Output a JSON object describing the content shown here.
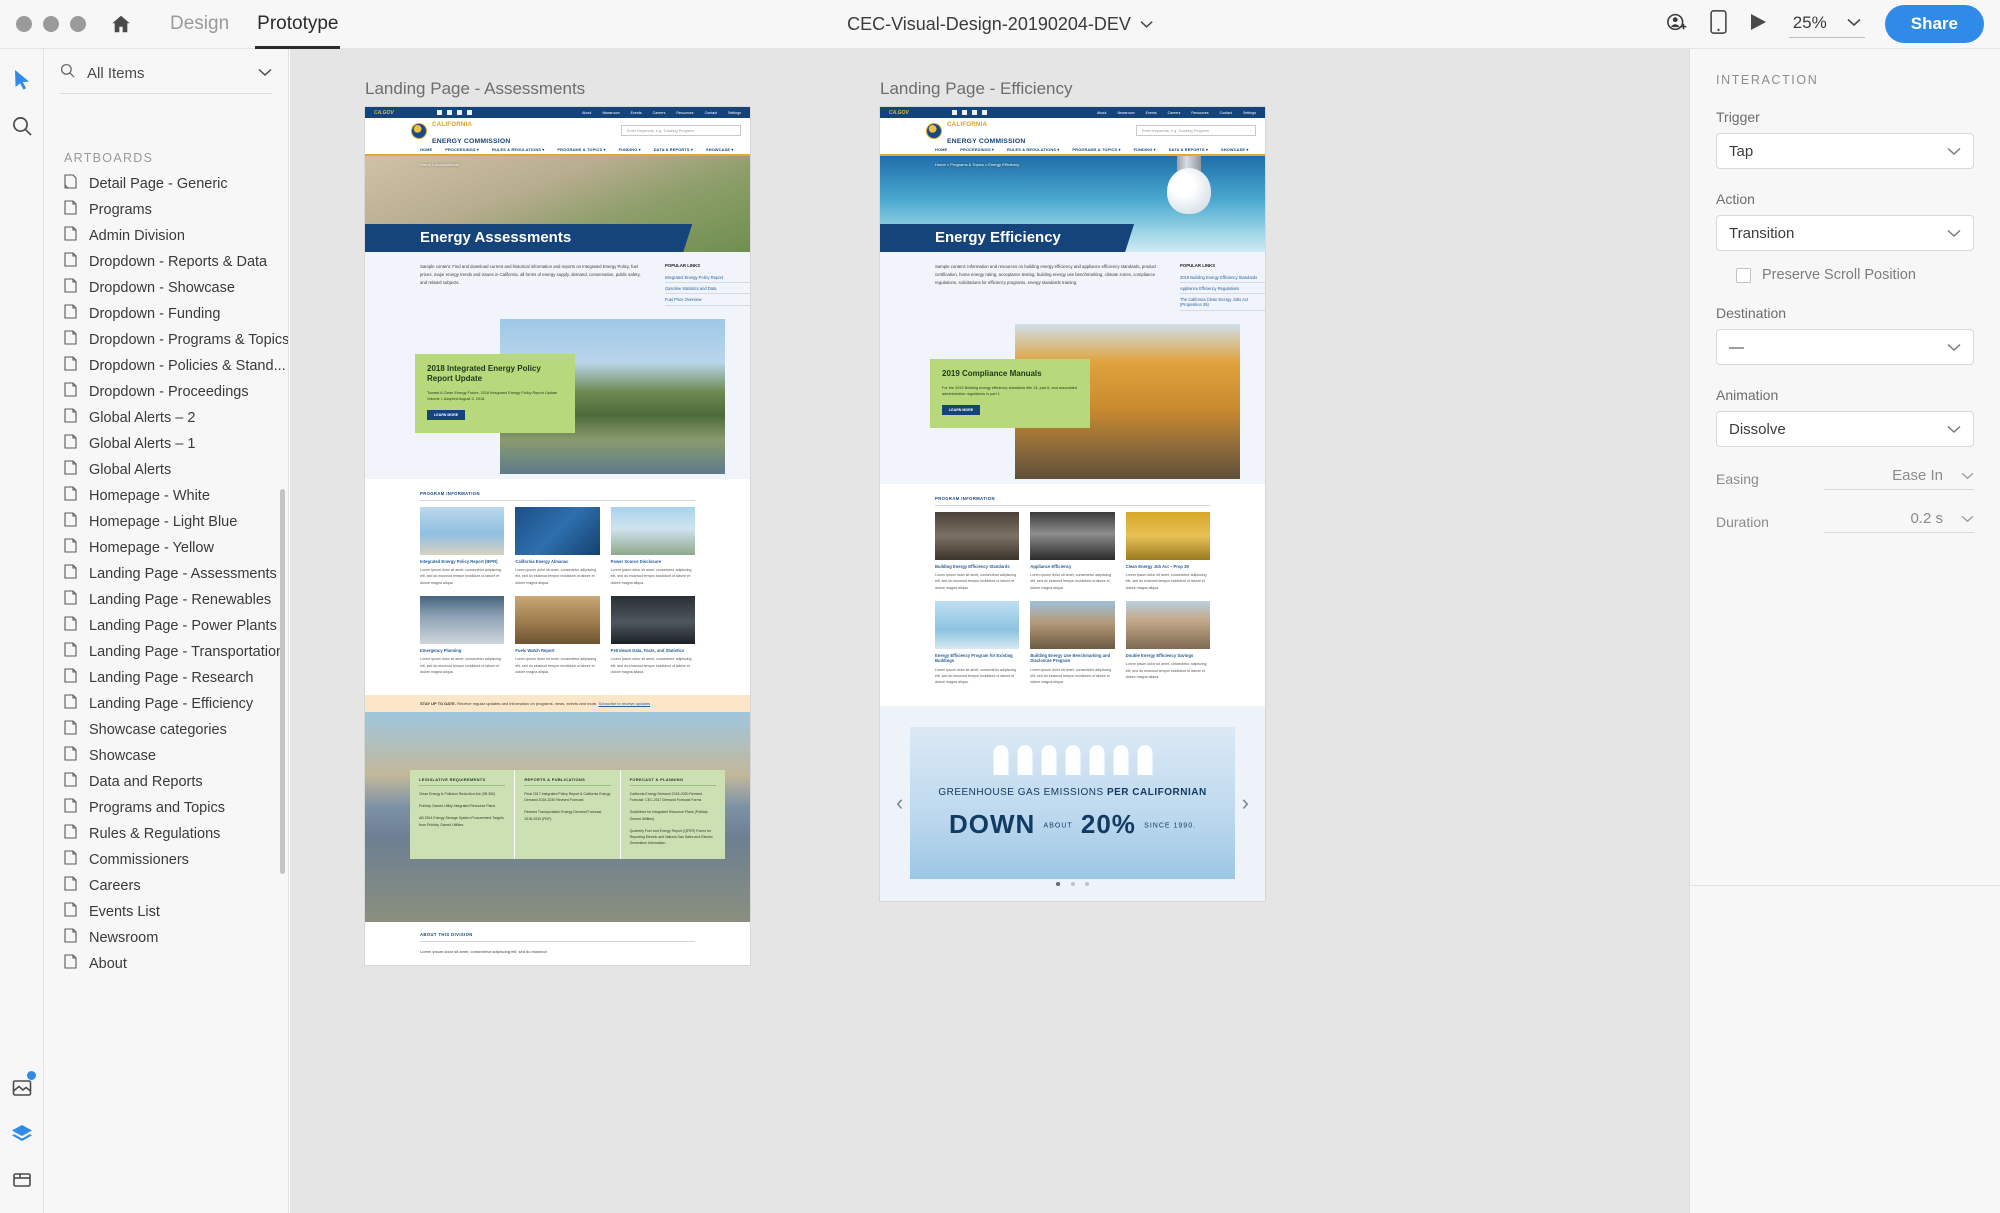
{
  "app": {
    "window_controls": [
      "close",
      "minimize",
      "maximize"
    ],
    "home_icon": "home-icon",
    "tabs": [
      {
        "label": "Design",
        "active": false
      },
      {
        "label": "Prototype",
        "active": true
      }
    ],
    "document_title": "CEC-Visual-Design-20190204-DEV",
    "title_chevron": "chevron-down-icon",
    "toolbar_right": {
      "coedit_icon": "add-collaborator-icon",
      "device_preview_icon": "mobile-device-icon",
      "play_icon": "play-desktop-preview-icon",
      "zoom_value": "25%",
      "zoom_chevron": "chevron-down-icon",
      "share_label": "Share"
    }
  },
  "toolrail": {
    "tools": [
      {
        "name": "select-tool",
        "icon": "cursor-icon",
        "selected": true
      },
      {
        "name": "zoom-tool",
        "icon": "magnifier-icon",
        "selected": false
      }
    ],
    "bottom_tools": [
      {
        "name": "assets-panel",
        "icon": "assets-icon",
        "badge": true
      },
      {
        "name": "layers-panel",
        "icon": "layers-icon",
        "selected": true
      },
      {
        "name": "libraries-panel",
        "icon": "libraries-icon",
        "selected": false
      }
    ]
  },
  "left_panel": {
    "search": {
      "icon": "search-icon",
      "value": "All Items",
      "chevron": "chevron-down-icon"
    },
    "section_header": "ARTBOARDS",
    "artboards": [
      {
        "label": "Detail Page - Generic",
        "icon": "artboard-icon-alt"
      },
      {
        "label": "Programs",
        "icon": "artboard-icon"
      },
      {
        "label": "Admin Division",
        "icon": "artboard-icon"
      },
      {
        "label": "Dropdown - Reports & Data",
        "icon": "artboard-icon"
      },
      {
        "label": "Dropdown - Showcase",
        "icon": "artboard-icon"
      },
      {
        "label": "Dropdown - Funding",
        "icon": "artboard-icon"
      },
      {
        "label": "Dropdown - Programs & Topics",
        "icon": "artboard-icon"
      },
      {
        "label": "Dropdown - Policies & Stand...",
        "icon": "artboard-icon"
      },
      {
        "label": "Dropdown - Proceedings",
        "icon": "artboard-icon"
      },
      {
        "label": "Global Alerts – 2",
        "icon": "artboard-icon"
      },
      {
        "label": "Global Alerts – 1",
        "icon": "artboard-icon"
      },
      {
        "label": "Global Alerts",
        "icon": "artboard-icon"
      },
      {
        "label": "Homepage - White",
        "icon": "artboard-icon"
      },
      {
        "label": "Homepage - Light Blue",
        "icon": "artboard-icon"
      },
      {
        "label": "Homepage - Yellow",
        "icon": "artboard-icon"
      },
      {
        "label": "Landing Page - Assessments",
        "icon": "artboard-icon"
      },
      {
        "label": "Landing Page - Renewables",
        "icon": "artboard-icon"
      },
      {
        "label": "Landing Page - Power Plants",
        "icon": "artboard-icon"
      },
      {
        "label": "Landing Page - Transportation",
        "icon": "artboard-icon"
      },
      {
        "label": "Landing Page - Research",
        "icon": "artboard-icon"
      },
      {
        "label": "Landing Page - Efficiency",
        "icon": "artboard-icon"
      },
      {
        "label": "Showcase categories",
        "icon": "artboard-icon"
      },
      {
        "label": "Showcase",
        "icon": "artboard-icon"
      },
      {
        "label": "Data and Reports",
        "icon": "artboard-icon"
      },
      {
        "label": "Programs and Topics",
        "icon": "artboard-icon"
      },
      {
        "label": "Rules & Regulations",
        "icon": "artboard-icon"
      },
      {
        "label": "Commissioners",
        "icon": "artboard-icon"
      },
      {
        "label": "Careers",
        "icon": "artboard-icon"
      },
      {
        "label": "Events List",
        "icon": "artboard-icon"
      },
      {
        "label": "Newsroom",
        "icon": "artboard-icon"
      },
      {
        "label": "About",
        "icon": "artboard-icon"
      }
    ]
  },
  "right_panel": {
    "title": "INTERACTION",
    "trigger": {
      "label": "Trigger",
      "value": "Tap"
    },
    "action": {
      "label": "Action",
      "value": "Transition"
    },
    "preserve_scroll": {
      "label": "Preserve Scroll Position",
      "checked": false
    },
    "destination": {
      "label": "Destination",
      "value": "—"
    },
    "animation": {
      "label": "Animation",
      "value": "Dissolve"
    },
    "easing": {
      "label": "Easing",
      "value": "Ease In"
    },
    "duration": {
      "label": "Duration",
      "value": "0.2 s"
    }
  },
  "canvas": {
    "artboards": [
      {
        "title": "Landing Page - Assessments",
        "site": {
          "utility_nav": [
            "About",
            "Newsroom",
            "Events",
            "Careers",
            "Resources",
            "Contact",
            "Settings"
          ],
          "social_icons": [
            "ca-gov-icon",
            "home-icon",
            "twitter-icon",
            "linkedin-icon",
            "instagram-icon"
          ],
          "brand_line1": "CALIFORNIA",
          "brand_line2": "ENERGY COMMISSION",
          "search_placeholder": "Enter Keywords, e.g. Tracking Progress",
          "main_nav": [
            "HOME",
            "PROCEEDINGS",
            "RULES & REGULATIONS",
            "PROGRAMS & TOPICS",
            "FUNDING",
            "DATA & REPORTS",
            "SHOWCASE"
          ],
          "breadcrumb": "Home  >  Assessments",
          "hero_title": "Energy Assessments",
          "intro": "Sample content: Find and download current and historical information and reports on Integrated Energy Policy, fuel prices, major energy trends and issues in California, all forms of energy supply, demand, conservation, public safety, and related subjects.",
          "popular_links_header": "POPULAR LINKS",
          "popular_links": [
            "Integrated Energy Policy Report",
            "Gasoline Statistics and Data",
            "Fuel Price Overview"
          ],
          "feature": {
            "title": "2018 Integrated Energy Policy Report Update",
            "body": "Toward A Clean Energy Future, 2018 Integrated Energy Policy Report Update Volume I, Adopted August 3, 2018.",
            "button": "LEARN MORE"
          },
          "program_info_header": "PROGRAM INFORMATION",
          "cards": [
            {
              "title": "Integrated Energy Policy Report (IEPR)",
              "body": "Lorem ipsum dolor sit amet, consectetur adipiscing elit, sed do eiusmod tempor incididunt ut labore et dolore magna aliqua."
            },
            {
              "title": "California Energy Almanac",
              "body": "Lorem ipsum dolor sit amet, consectetur adipiscing elit, sed do eiusmod tempor incididunt ut labore et dolore magna aliqua."
            },
            {
              "title": "Power Source Disclosure",
              "body": "Lorem ipsum dolor sit amet, consectetur adipiscing elit, sed do eiusmod tempor incididunt ut labore et dolore magna aliqua."
            },
            {
              "title": "Emergency Planning",
              "body": "Lorem ipsum dolor sit amet, consectetur adipiscing elit, sed do eiusmod tempor incididunt ut labore et dolore magna aliqua."
            },
            {
              "title": "Fuels Watch Report",
              "body": "Lorem ipsum dolor sit amet, consectetur adipiscing elit, sed do eiusmod tempor incididunt ut labore et dolore magna aliqua."
            },
            {
              "title": "Petroleum Data, Facts, and Statistics",
              "body": "Lorem ipsum dolor sit amet, consectetur adipiscing elit, sed do eiusmod tempor incididunt ut labore et dolore magna aliqua."
            }
          ],
          "stay_up_to_date": "STAY UP TO DATE.",
          "stay_up_to_date_body": "Receive regular updates and information on programs, news, events and more.",
          "stay_up_to_date_link": "Subscribe to receive updates",
          "bottom_columns": [
            {
              "header": "LEGISLATIVE REQUIREMENTS",
              "items": [
                "Clean Energy & Pollution Reduction Act (SB 350)",
                "Publicly Owned Utility Integrated Resource Plans",
                "AB 2514 Energy Storage System Procurement Targets from Publicly Owned Utilities"
              ]
            },
            {
              "header": "REPORTS & PUBLICATIONS",
              "items": [
                "Final 2017 Integrated Policy Report & California Energy Demand 2018-2030 Revised Forecast",
                "Revised Transportation Energy Demand Forecast, 2018-2030 (PDF)"
              ]
            },
            {
              "header": "FORECAST & PLANNING",
              "items": [
                "California Energy Demand 2018-2030 Revised Forecast: CEC-2017 Demand Forecast Forms",
                "Guidelines for Integrated Resource Plans (Publicly Owned Utilities)",
                "Quarterly Fuel and Energy Report (QFER) Forms for Reporting Electric and Natural Gas Sales and Electric Generation Information"
              ]
            }
          ],
          "about_header": "ABOUT THIS DIVISION",
          "about_body": "Lorem ipsum dolor sit amet, consectetur adipiscing elit, sed do eiusmod"
        }
      },
      {
        "title": "Landing Page - Efficiency",
        "site": {
          "utility_nav": [
            "About",
            "Newsroom",
            "Events",
            "Careers",
            "Resources",
            "Contact",
            "Settings"
          ],
          "social_icons": [
            "ca-gov-icon",
            "home-icon",
            "twitter-icon",
            "linkedin-icon",
            "instagram-icon"
          ],
          "brand_line1": "CALIFORNIA",
          "brand_line2": "ENERGY COMMISSION",
          "search_placeholder": "Enter Keywords, e.g. Tracking Progress",
          "main_nav": [
            "HOME",
            "PROCEEDINGS",
            "RULES & REGULATIONS",
            "PROGRAMS & TOPICS",
            "FUNDING",
            "DATA & REPORTS",
            "SHOWCASE"
          ],
          "breadcrumb": "Home  >  Programs & Topics  >  Energy Efficiency",
          "hero_title": "Energy Efficiency",
          "intro": "Sample content: Information and resources on building energy efficiency and appliance efficiency standards, product certification, home energy rating, acceptance testing, building energy use benchmarking, climate zones, compliance regulations, solicitations for efficiency programs, energy standards training.",
          "popular_links_header": "POPULAR LINKS",
          "popular_links": [
            "2019 Building Energy Efficiency Standards",
            "Appliance Efficiency Regulations",
            "The California Clean Energy Jobs Act (Proposition 39)"
          ],
          "feature": {
            "title": "2019 Compliance Manuals",
            "body": "For the 2019 Building energy efficiency standards title 24, part 6, and associated administrative regulations in part 1.",
            "button": "LEARN MORE"
          },
          "program_info_header": "PROGRAM INFORMATION",
          "cards": [
            {
              "title": "Building Energy Efficiency Standards",
              "body": "Lorem ipsum dolor sit amet, consectetur adipiscing elit, sed do eiusmod tempor incididunt ut labore et dolore magna aliqua."
            },
            {
              "title": "Appliance Efficiency",
              "body": "Lorem ipsum dolor sit amet, consectetur adipiscing elit, sed do eiusmod tempor incididunt ut labore et dolore magna aliqua."
            },
            {
              "title": "Clean Energy Job Act – Prop 39",
              "body": "Lorem ipsum dolor sit amet, consectetur adipiscing elit, sed do eiusmod tempor incididunt ut labore et dolore magna aliqua."
            },
            {
              "title": "Energy Efficiency Program for Existing Buildings",
              "body": "Lorem ipsum dolor sit amet, consectetur adipiscing elit, sed do eiusmod tempor incididunt ut labore et dolore magna aliqua."
            },
            {
              "title": "Building Energy Use Benchmarking and Disclosure Program",
              "body": "Lorem ipsum dolor sit amet, consectetur adipiscing elit, sed do eiusmod tempor incididunt ut labore et dolore magna aliqua."
            },
            {
              "title": "Double Energy Efficiency Savings",
              "body": "Lorem ipsum dolor sit amet, consectetur adipiscing elit, sed do eiusmod tempor incididunt ut labore et dolore magna aliqua."
            }
          ],
          "carousel": {
            "line1_a": "GREENHOUSE GAS EMISSIONS",
            "line1_b": " PER CALIFORNIAN",
            "line2_a": "DOWN",
            "line2_about": "ABOUT",
            "line2_b": "20%",
            "line2_c": "SINCE 1990.",
            "prev_icon": "chevron-left-icon",
            "next_icon": "chevron-right-icon",
            "dots": 3,
            "active_dot": 0
          }
        }
      }
    ]
  }
}
